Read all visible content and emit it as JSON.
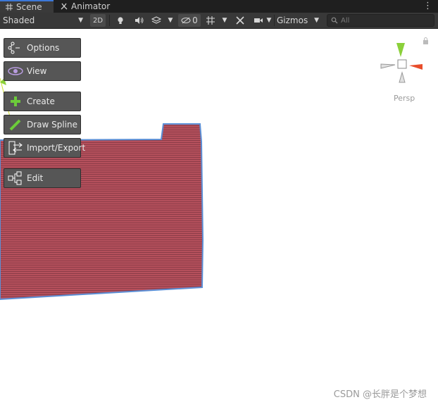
{
  "tabs": [
    {
      "label": "Scene",
      "icon": "grid-icon"
    },
    {
      "label": "Animator",
      "icon": "animator-icon"
    }
  ],
  "toolbar": {
    "shading_mode": "Shaded",
    "mode_2d": "2D",
    "hidden_count": "0",
    "gizmos_label": "Gizmos",
    "search_placeholder": "All"
  },
  "overlay_buttons": [
    {
      "label": "Options",
      "icon": "options-icon"
    },
    {
      "label": "View",
      "icon": "eye-icon"
    },
    {
      "label": "Create",
      "icon": "plus-icon"
    },
    {
      "label": "Draw Spline",
      "icon": "pencil-icon"
    },
    {
      "label": "Import/Export",
      "icon": "import-export-icon"
    },
    {
      "label": "Edit",
      "icon": "edit-nodes-icon"
    }
  ],
  "scene": {
    "projection_label": "Persp",
    "shape_fill": "#b5505c",
    "shape_outline": "#5b8fd6"
  },
  "watermark": "CSDN @长胖是个梦想"
}
